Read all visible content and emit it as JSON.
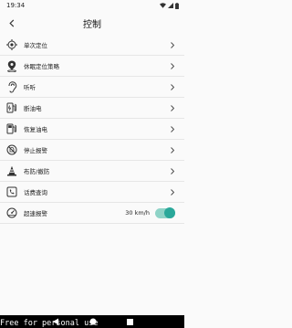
{
  "status_bar": {
    "time": "19:34"
  },
  "header": {
    "title": "控制"
  },
  "menu": [
    {
      "label": "单次定位",
      "icon": "crosshair-icon"
    },
    {
      "label": "休眠定位策略",
      "icon": "map-pin-icon"
    },
    {
      "label": "听听",
      "icon": "ear-icon"
    },
    {
      "label": "断油电",
      "icon": "fuel-cut-icon"
    },
    {
      "label": "恢复油电",
      "icon": "fuel-restore-icon"
    },
    {
      "label": "停止报警",
      "icon": "alarm-off-icon"
    },
    {
      "label": "布防/撤防",
      "icon": "traffic-cone-icon"
    },
    {
      "label": "话费查询",
      "icon": "phone-bill-icon"
    }
  ],
  "overspeed": {
    "label": "超速报警",
    "value": "30 km/h",
    "enabled": true,
    "icon": "speedometer-icon"
  },
  "watermark": "Free for personal use",
  "colors": {
    "accent": "#2aa89a"
  }
}
